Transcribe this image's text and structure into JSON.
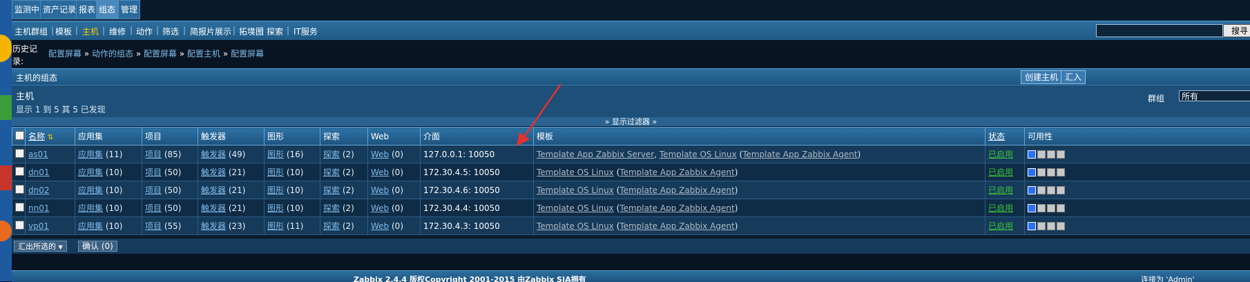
{
  "top_tabs": [
    "监测中",
    "资产记录",
    "报表",
    "组态",
    "管理"
  ],
  "sub_nav": [
    "主机群组",
    "模板",
    "主机",
    "维修",
    "动作",
    "筛选",
    "简报片展示",
    "拓墣图",
    "探索",
    "IT服务"
  ],
  "search": {
    "button": "搜寻",
    "value": ""
  },
  "history": {
    "label": "历史记录:",
    "crumbs": [
      "配置屏幕",
      "动作的组态",
      "配置屏幕",
      "配置主机",
      "配置屏幕"
    ],
    "separator": "»"
  },
  "config_bar": {
    "title": "主机的组态",
    "create_button": "创建主机",
    "import_button": "汇入"
  },
  "hosts_header": {
    "title": "主机",
    "count_text": "显示 1 到 5 其 5 已发现",
    "group_label": "群组",
    "group_value": "所有"
  },
  "filter_toggle": "显示过滤器",
  "table": {
    "columns": [
      "名称",
      "应用集",
      "项目",
      "触发器",
      "图形",
      "探索",
      "Web",
      "介面",
      "模板",
      "状态",
      "可用性"
    ],
    "rows": [
      {
        "name": "as01",
        "apps_label": "应用集",
        "apps": "(11)",
        "items_label": "项目",
        "items": "(85)",
        "triggers_label": "触发器",
        "triggers": "(49)",
        "graphs_label": "图形",
        "graphs": "(16)",
        "disc_label": "探索",
        "disc": "(2)",
        "web_label": "Web",
        "web": "(0)",
        "iface": "127.0.0.1: 10050",
        "tmpl1": "Template App Zabbix Server",
        "tmpl_sep": ", ",
        "tmpl2": "Template OS Linux",
        "tmpl3": "Template App Zabbix Agent",
        "status": "已启用"
      },
      {
        "name": "dn01",
        "apps_label": "应用集",
        "apps": "(10)",
        "items_label": "项目",
        "items": "(50)",
        "triggers_label": "触发器",
        "triggers": "(21)",
        "graphs_label": "图形",
        "graphs": "(10)",
        "disc_label": "探索",
        "disc": "(2)",
        "web_label": "Web",
        "web": "(0)",
        "iface": "172.30.4.5: 10050",
        "tmpl1": "Template OS Linux",
        "tmpl_sep": "",
        "tmpl2": "",
        "tmpl3": "Template App Zabbix Agent",
        "status": "已启用"
      },
      {
        "name": "dn02",
        "apps_label": "应用集",
        "apps": "(10)",
        "items_label": "项目",
        "items": "(50)",
        "triggers_label": "触发器",
        "triggers": "(21)",
        "graphs_label": "图形",
        "graphs": "(10)",
        "disc_label": "探索",
        "disc": "(2)",
        "web_label": "Web",
        "web": "(0)",
        "iface": "172.30.4.6: 10050",
        "tmpl1": "Template OS Linux",
        "tmpl_sep": "",
        "tmpl2": "",
        "tmpl3": "Template App Zabbix Agent",
        "status": "已启用"
      },
      {
        "name": "nn01",
        "apps_label": "应用集",
        "apps": "(10)",
        "items_label": "项目",
        "items": "(50)",
        "triggers_label": "触发器",
        "triggers": "(21)",
        "graphs_label": "图形",
        "graphs": "(10)",
        "disc_label": "探索",
        "disc": "(2)",
        "web_label": "Web",
        "web": "(0)",
        "iface": "172.30.4.4: 10050",
        "tmpl1": "Template OS Linux",
        "tmpl_sep": "",
        "tmpl2": "",
        "tmpl3": "Template App Zabbix Agent",
        "status": "已启用"
      },
      {
        "name": "vp01",
        "apps_label": "应用集",
        "apps": "(10)",
        "items_label": "项目",
        "items": "(55)",
        "triggers_label": "触发器",
        "triggers": "(23)",
        "graphs_label": "图形",
        "graphs": "(11)",
        "disc_label": "探索",
        "disc": "(2)",
        "web_label": "Web",
        "web": "(0)",
        "iface": "172.30.4.3: 10050",
        "tmpl1": "Template OS Linux",
        "tmpl_sep": "",
        "tmpl2": "",
        "tmpl3": "Template App Zabbix Agent",
        "status": "已启用"
      }
    ]
  },
  "bottom": {
    "action_select": "汇出所选的",
    "confirm_button": "确认 (0)"
  },
  "footer": {
    "text": "Zabbix 2.4.4 版权Copyright 2001-2015 由Zabbix SIA拥有",
    "user": "连接为 'Admin'"
  },
  "colors": {
    "bg": "#0b1a2b",
    "bar": "#2d6f9f",
    "link": "#7fb8e6",
    "active_nav": "#ffcc00",
    "enabled": "#39c239",
    "annotation": "#e8302a"
  }
}
